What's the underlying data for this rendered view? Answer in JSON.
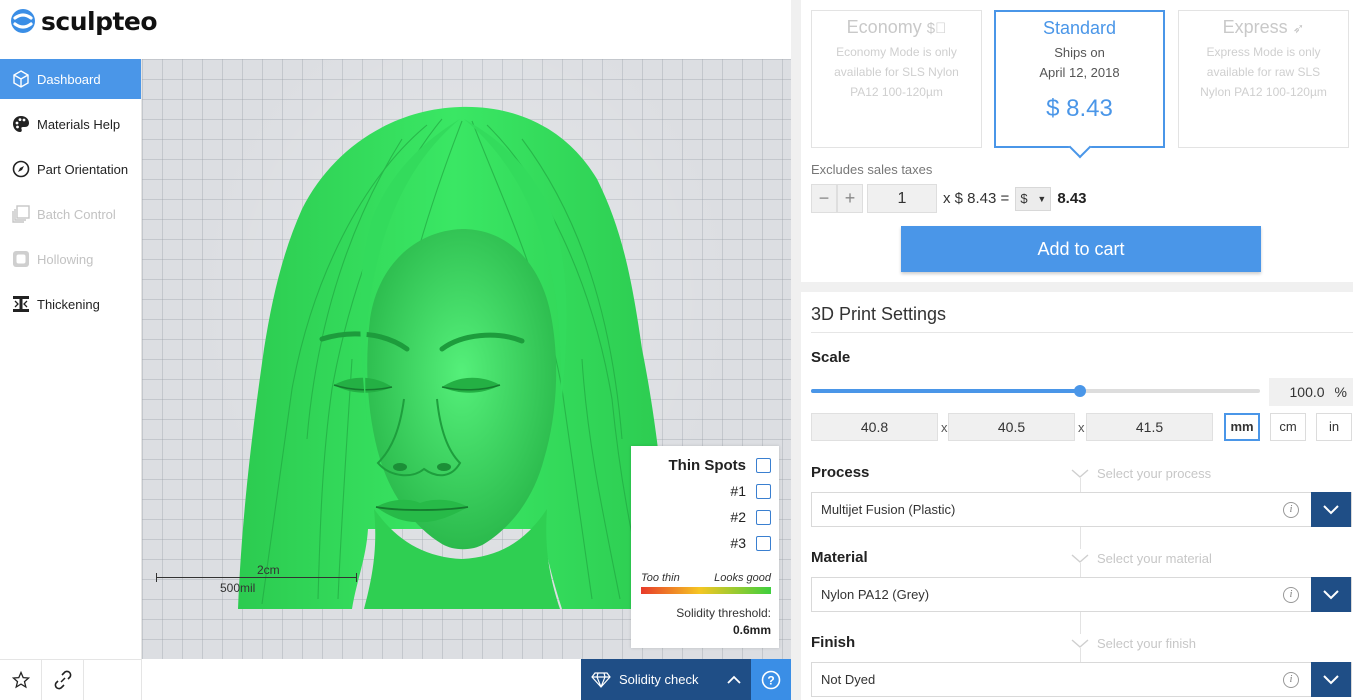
{
  "brand": {
    "name": "sculpteo"
  },
  "sidebar": {
    "items": [
      {
        "label": "Dashboard"
      },
      {
        "label": "Materials Help"
      },
      {
        "label": "Part Orientation"
      },
      {
        "label": "Batch Control"
      },
      {
        "label": "Hollowing"
      },
      {
        "label": "Thickening"
      }
    ]
  },
  "viewport": {
    "scale_bar": {
      "top_label": "2cm",
      "bottom_label": "500mil"
    },
    "thin_spots": {
      "title": "Thin Spots",
      "options": [
        "#1",
        "#2",
        "#3"
      ],
      "legend_low": "Too thin",
      "legend_high": "Looks good",
      "threshold_label": "Solidity threshold:",
      "threshold_value": "0.6mm"
    }
  },
  "solidity": {
    "label": "Solidity check",
    "help": "?"
  },
  "pricing": {
    "tiers": [
      {
        "name": "Economy",
        "desc": "Economy Mode is only available for SLS Nylon PA12 100-120µm"
      },
      {
        "name": "Standard",
        "line1": "Ships on",
        "line2": "April 12, 2018",
        "price": "$ 8.43"
      },
      {
        "name": "Express",
        "desc": "Express Mode is only available for raw SLS Nylon PA12 100-120µm"
      }
    ],
    "tax_note": "Excludes sales taxes",
    "quantity": "1",
    "unit_price_text": "x $ 8.43 =",
    "currency": "$",
    "total": "8.43",
    "add_to_cart": "Add to cart"
  },
  "settings": {
    "heading": "3D Print Settings",
    "scale": {
      "label": "Scale",
      "percent": "100.0",
      "percent_unit": "%",
      "slider_fraction": 0.6,
      "dims": [
        "40.8",
        "40.5",
        "41.5"
      ],
      "separator": "x",
      "units": [
        "mm",
        "cm",
        "in"
      ],
      "active_unit": "mm"
    },
    "process": {
      "label": "Process",
      "hint": "Select your process",
      "value": "Multijet Fusion (Plastic)"
    },
    "material": {
      "label": "Material",
      "hint": "Select your material",
      "value": "Nylon PA12 (Grey)"
    },
    "finish": {
      "label": "Finish",
      "hint": "Select your finish",
      "value": "Not Dyed"
    }
  },
  "colors": {
    "accent": "#4a96e8",
    "navy": "#1f4e86",
    "model_green": "#33e05a"
  }
}
